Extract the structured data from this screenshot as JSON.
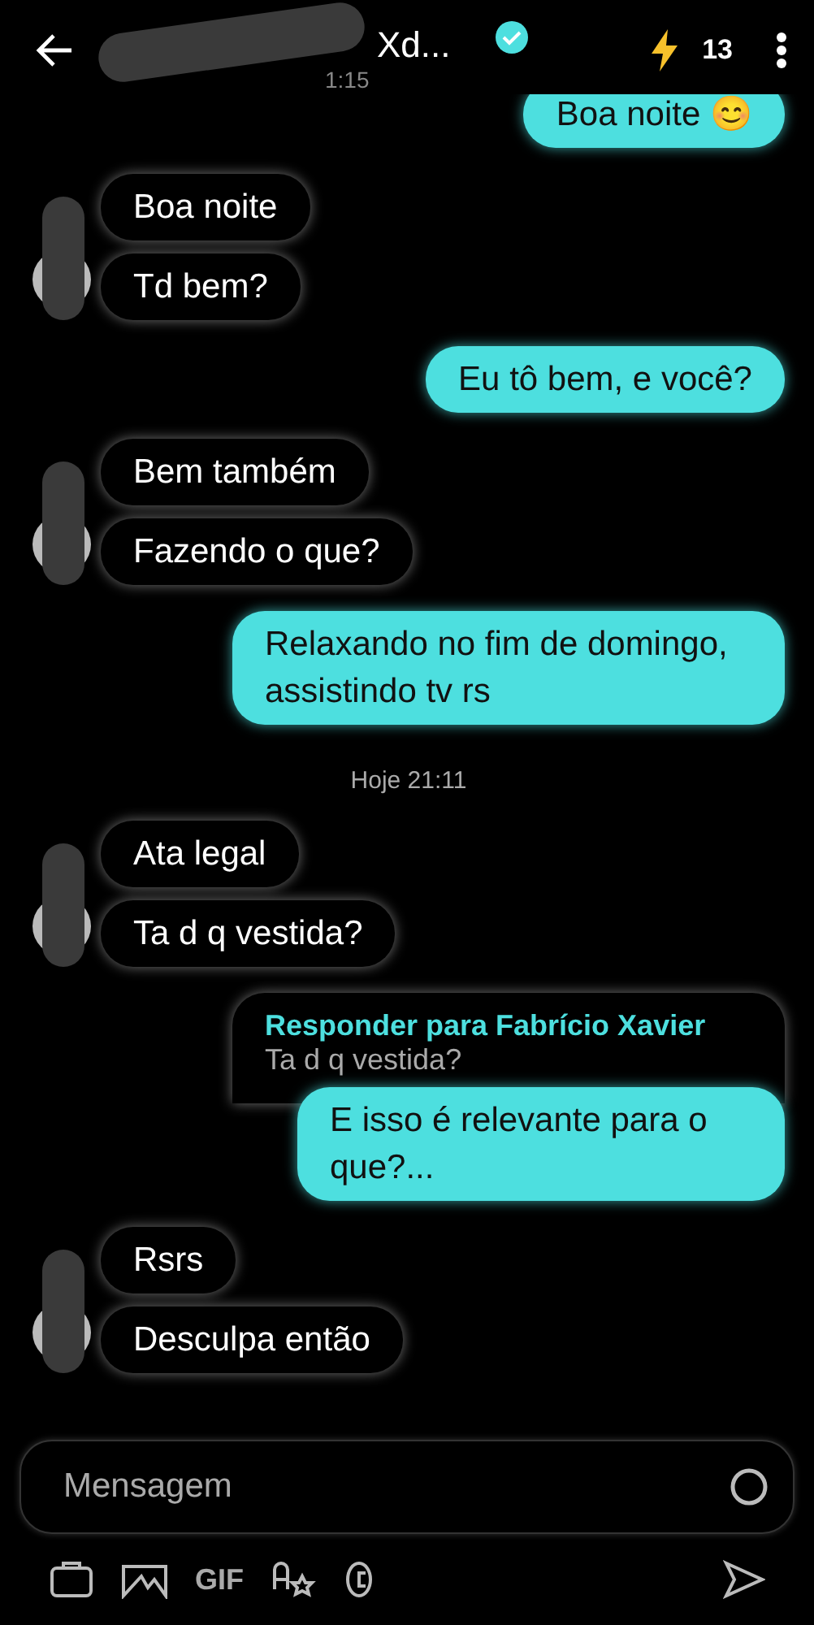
{
  "header": {
    "title": "Xd...",
    "subtitle": "1:15",
    "verified": true,
    "count": "13"
  },
  "messages": [
    {
      "kind": "outgoing",
      "bubbles": [
        "Boa noite 😊"
      ]
    },
    {
      "kind": "incoming",
      "bubbles": [
        "Boa noite",
        "Td bem?"
      ]
    },
    {
      "kind": "outgoing",
      "bubbles": [
        "Eu tô bem, e você?"
      ]
    },
    {
      "kind": "incoming",
      "bubbles": [
        "Bem também",
        "Fazendo o que?"
      ]
    },
    {
      "kind": "outgoing",
      "bubbles": [
        "Relaxando no fim de domingo, assistindo tv rs"
      ]
    },
    {
      "kind": "date",
      "text": "Hoje 21:11"
    },
    {
      "kind": "incoming",
      "bubbles": [
        "Ata legal",
        "Ta d q vestida?"
      ]
    },
    {
      "kind": "outgoing",
      "reply": {
        "to": "Responder para Fabrício Xavier",
        "text": "Ta d q vestida?"
      },
      "bubbles": [
        "E isso é relevante para o que?..."
      ]
    },
    {
      "kind": "incoming",
      "bubbles": [
        "Rsrs",
        "Desculpa então"
      ]
    }
  ],
  "composer": {
    "placeholder": "Mensagem",
    "gif": "GIF"
  }
}
